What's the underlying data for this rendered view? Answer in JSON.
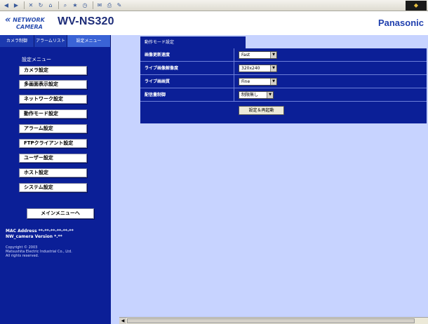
{
  "header": {
    "brand_line1": "NETWORK",
    "brand_line2": "CAMERA",
    "model": "WV-NS320",
    "maker": "Panasonic"
  },
  "sidebar": {
    "tabs": [
      "カメラ制御",
      "アラームリスト",
      "設定メニュー"
    ],
    "menu_heading": "設定メニュー",
    "items": [
      {
        "label": "カメラ設定"
      },
      {
        "label": "多画面表示設定"
      },
      {
        "label": "ネットワーク設定"
      },
      {
        "label": "動作モード設定"
      },
      {
        "label": "アラーム設定"
      },
      {
        "label": "FTPクライアント設定"
      },
      {
        "label": "ユーザー設定"
      },
      {
        "label": "ホスト設定"
      },
      {
        "label": "システム設定"
      }
    ],
    "main_menu_button": "メインメニューへ",
    "mac_line": "MAC Address **-**-**-**-**-**",
    "version_line": "NW_camera Version *.**",
    "copyright": [
      "Copyright © 2003",
      "Matsushita Electric Industrial Co., Ltd.",
      "All rights reserved."
    ]
  },
  "main": {
    "section_title": "動作モード設定",
    "rows": [
      {
        "label": "画像更新速度",
        "value": "Fast"
      },
      {
        "label": "ライブ画像解像度",
        "value": "320x240"
      },
      {
        "label": "ライブ画画質",
        "value": "Fine"
      },
      {
        "label": "配信量制御",
        "value": "制限無し"
      }
    ],
    "apply_button": "設定＆再起動"
  },
  "colors": {
    "panel": "#0b1f97",
    "content_bg": "#c7d3ff",
    "brand_blue": "#1f3fae"
  }
}
